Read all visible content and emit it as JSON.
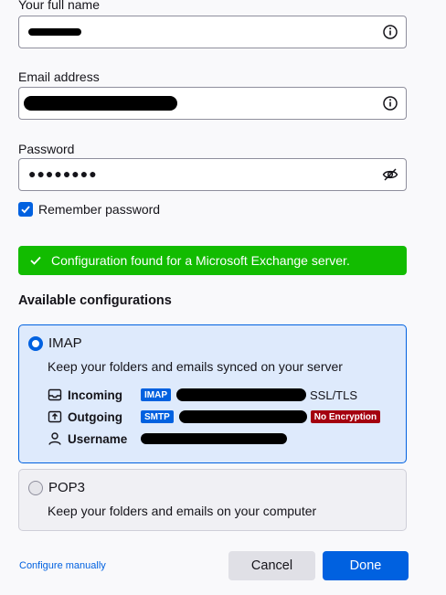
{
  "full_name": {
    "label": "Your full name",
    "info_icon": "info-icon"
  },
  "email": {
    "label": "Email address",
    "info_icon": "info-icon"
  },
  "password": {
    "label": "Password",
    "value": "●●●●●●●●",
    "visibility_icon": "eye-slash-icon"
  },
  "remember_password": {
    "label": "Remember password",
    "checked": true
  },
  "status": {
    "message": "Configuration found for a Microsoft Exchange server.",
    "icon": "checkmark-icon",
    "color": "#12bc00"
  },
  "available": {
    "title": "Available configurations",
    "options": [
      {
        "name": "IMAP",
        "description": "Keep your folders and emails synced on your server",
        "selected": true,
        "incoming": {
          "label": "Incoming",
          "protocol": "IMAP",
          "security": "SSL/TLS",
          "icon": "inbox-icon"
        },
        "outgoing": {
          "label": "Outgoing",
          "protocol": "SMTP",
          "security": "No Encryption",
          "icon": "outbox-icon"
        },
        "username": {
          "label": "Username",
          "icon": "user-icon"
        }
      },
      {
        "name": "POP3",
        "description": "Keep your folders and emails on your computer",
        "selected": false
      }
    ]
  },
  "footer": {
    "configure_manually": "Configure manually",
    "cancel": "Cancel",
    "done": "Done"
  },
  "colors": {
    "accent": "#0061e0",
    "success": "#12bc00",
    "danger": "#a4000f"
  }
}
